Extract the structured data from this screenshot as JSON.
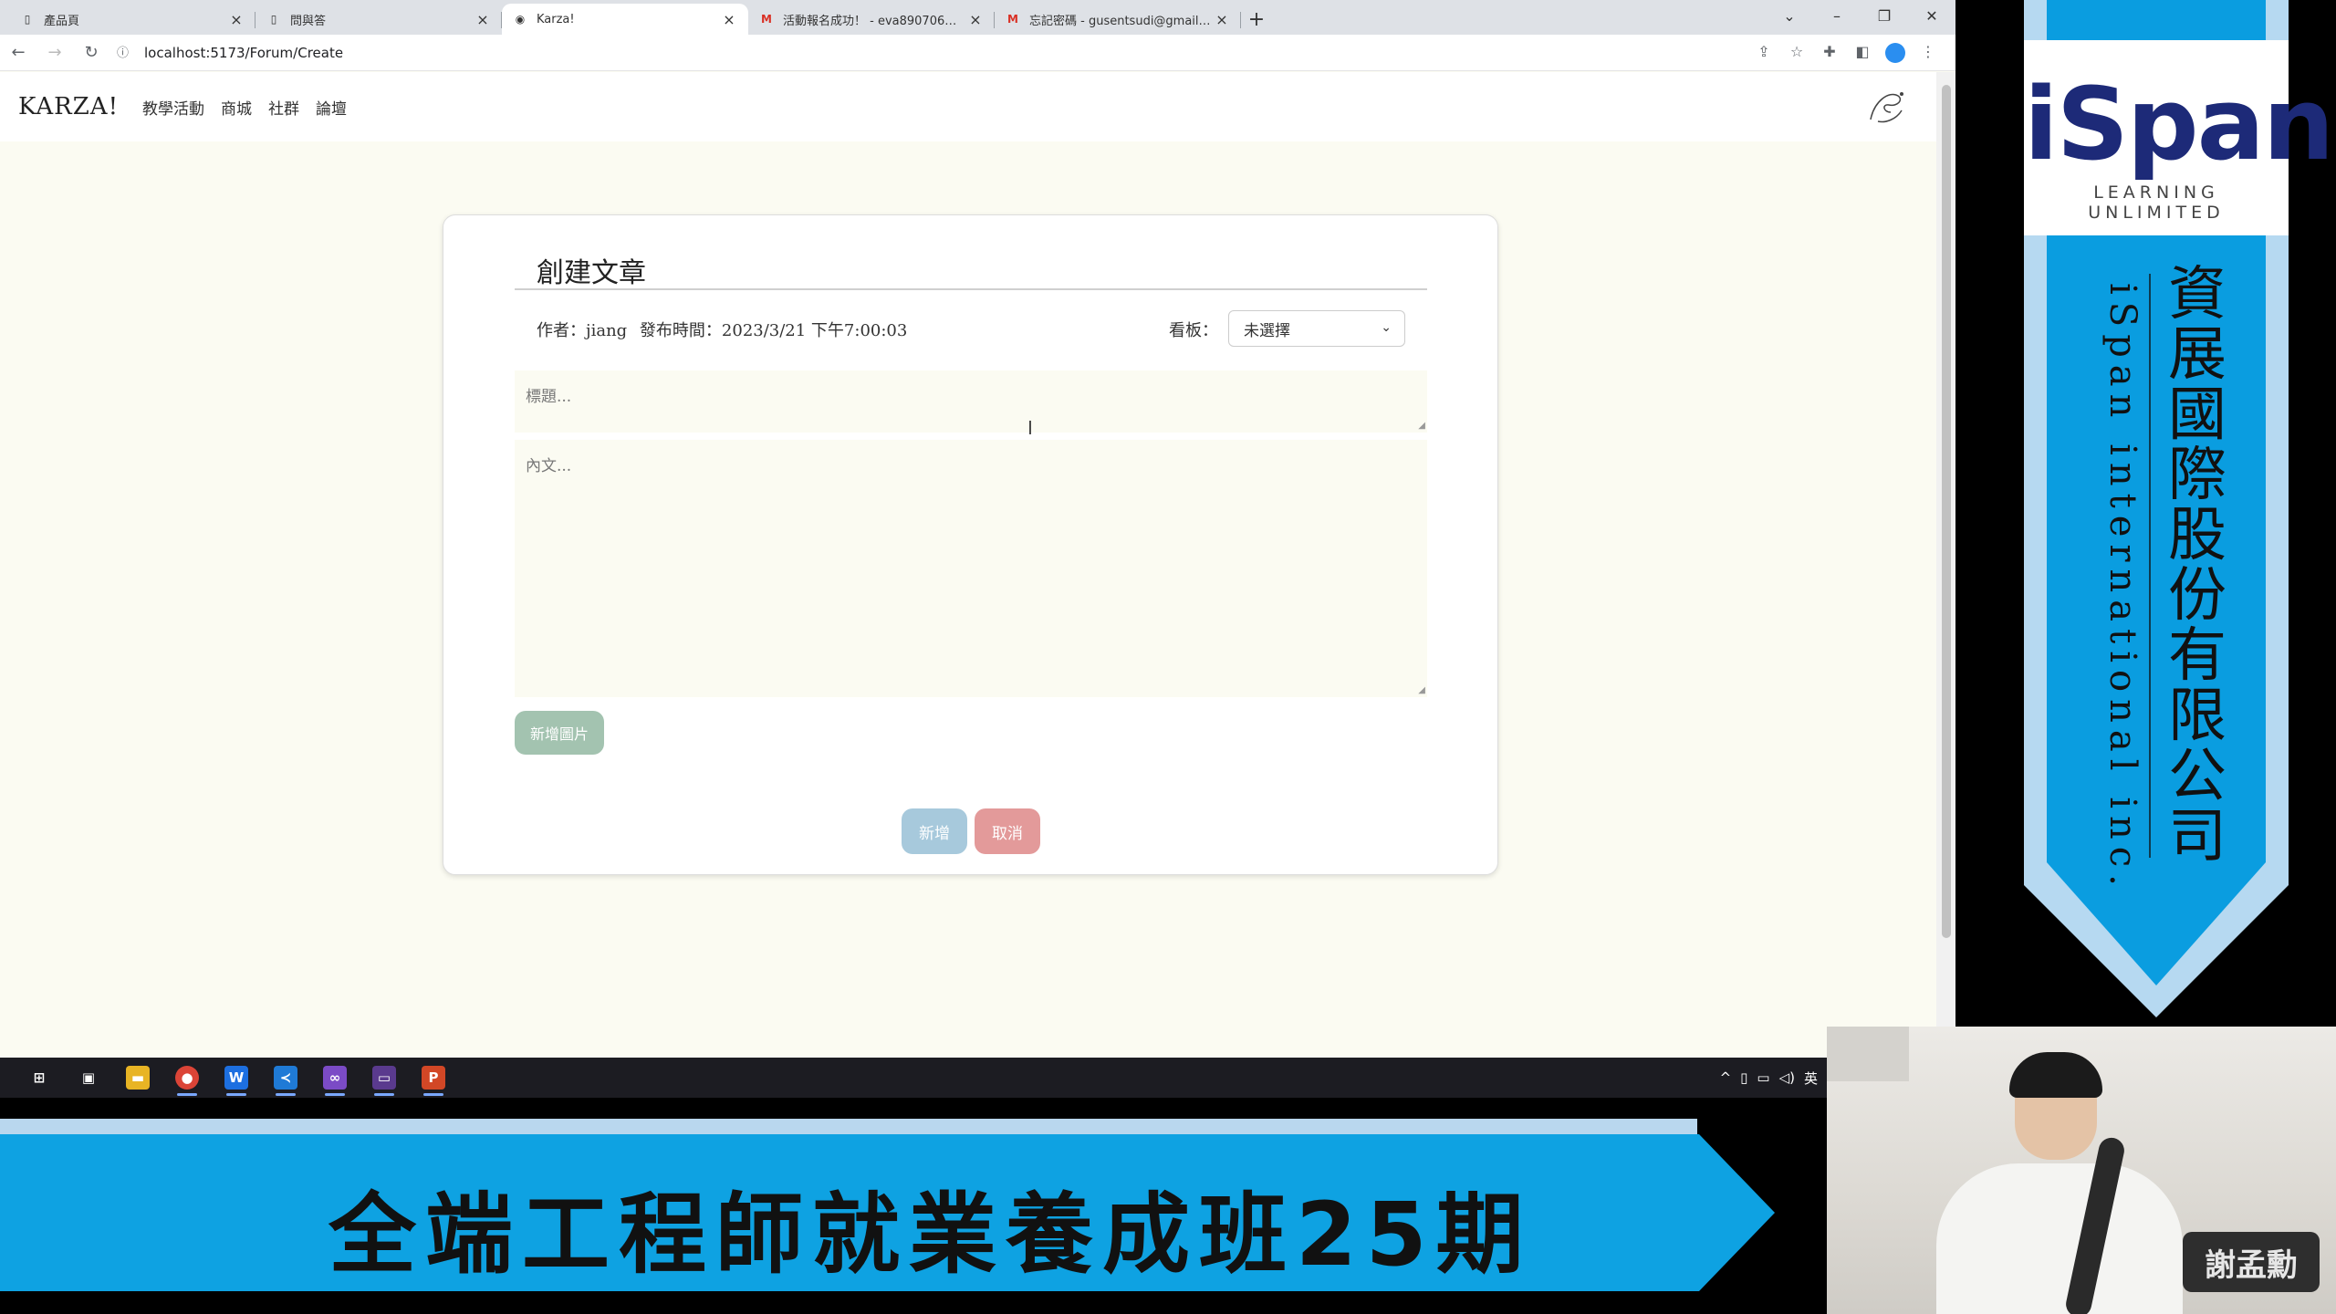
{
  "browser": {
    "tabs": [
      {
        "label": "產品頁",
        "active": false
      },
      {
        "label": "問與答",
        "active": false
      },
      {
        "label": "Karza!",
        "active": true
      },
      {
        "label": "活動報名成功！ - eva890706@gmail.com",
        "active": false
      },
      {
        "label": "忘記密碼 - gusentsudi@gmail.com",
        "active": false
      }
    ],
    "url": "localhost:5173/Forum/Create"
  },
  "site": {
    "brand": "KARZA!",
    "nav": [
      "教學活動",
      "商城",
      "社群",
      "論壇"
    ]
  },
  "form": {
    "title": "創建文章",
    "author_label": "作者：jiang",
    "time_label": "發布時間：2023/3/21 下午7:00:03",
    "board_label": "看板：",
    "board_selected": "未選擇",
    "title_placeholder": "標題...",
    "body_placeholder": "內文...",
    "add_image_label": "新增圖片",
    "submit_label": "新增",
    "cancel_label": "取消"
  },
  "taskbar": {
    "tray_lang": "英"
  },
  "banner": {
    "text": "全端工程師就業養成班25期"
  },
  "ribbon": {
    "logo": "iSpan",
    "tagline": "LEARNING UNLIMITED",
    "company_cn": "資展國際股份有限公司",
    "company_en": "iSpan international inc."
  },
  "webcam": {
    "nameplate": "謝孟勳"
  },
  "colors": {
    "page_bg": "#fbfbf2",
    "add_image_btn": "#a3c3b0",
    "submit_btn": "#a7c9dc",
    "cancel_btn": "#e39a9a",
    "banner_blue": "#0ea2e2",
    "logo_navy": "#1d2a78"
  }
}
